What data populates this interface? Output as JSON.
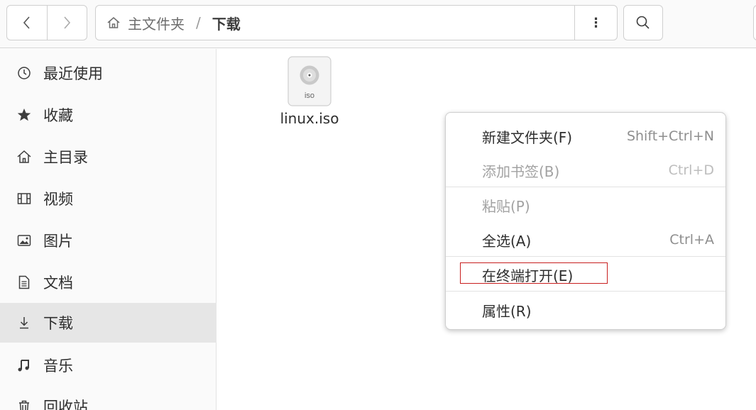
{
  "header": {
    "back_icon": "chevron-left-icon",
    "forward_icon": "chevron-right-icon",
    "path": {
      "home_icon": "home-icon",
      "home_label": "主文件夹",
      "separator": "/",
      "current": "下载"
    },
    "menu_glyph": "⋮",
    "search_icon": "search-icon"
  },
  "sidebar": {
    "items": [
      {
        "icon": "clock-icon",
        "label": "最近使用"
      },
      {
        "icon": "star-icon",
        "label": "收藏"
      },
      {
        "icon": "home-icon",
        "label": "主目录"
      },
      {
        "icon": "film-icon",
        "label": "视频"
      },
      {
        "icon": "picture-icon",
        "label": "图片"
      },
      {
        "icon": "document-icon",
        "label": "文档"
      },
      {
        "icon": "download-icon",
        "label": "下载",
        "active": true
      },
      {
        "icon": "music-icon",
        "label": "音乐"
      },
      {
        "icon": "trash-icon",
        "label": "回收站"
      }
    ]
  },
  "content": {
    "files": [
      {
        "name": "linux.iso",
        "icon": "disc-image-icon",
        "icon_text": "iso"
      }
    ]
  },
  "context_menu": {
    "items": [
      {
        "label": "新建文件夹(F)",
        "accel": "Shift+Ctrl+N",
        "enabled": true
      },
      {
        "label": "添加书签(B)",
        "accel": "Ctrl+D",
        "enabled": false
      },
      {
        "label": "粘贴(P)",
        "accel": "",
        "enabled": false
      },
      {
        "label": "全选(A)",
        "accel": "Ctrl+A",
        "enabled": true
      },
      {
        "label": "在终端打开(E)",
        "accel": "",
        "enabled": true,
        "highlighted": true
      },
      {
        "label": "属性(R)",
        "accel": "",
        "enabled": true
      }
    ]
  },
  "colors": {
    "highlight_box": "#c81e1e",
    "sidebar_active": "#e6e6e6",
    "disabled_text": "#a2a2a2"
  }
}
